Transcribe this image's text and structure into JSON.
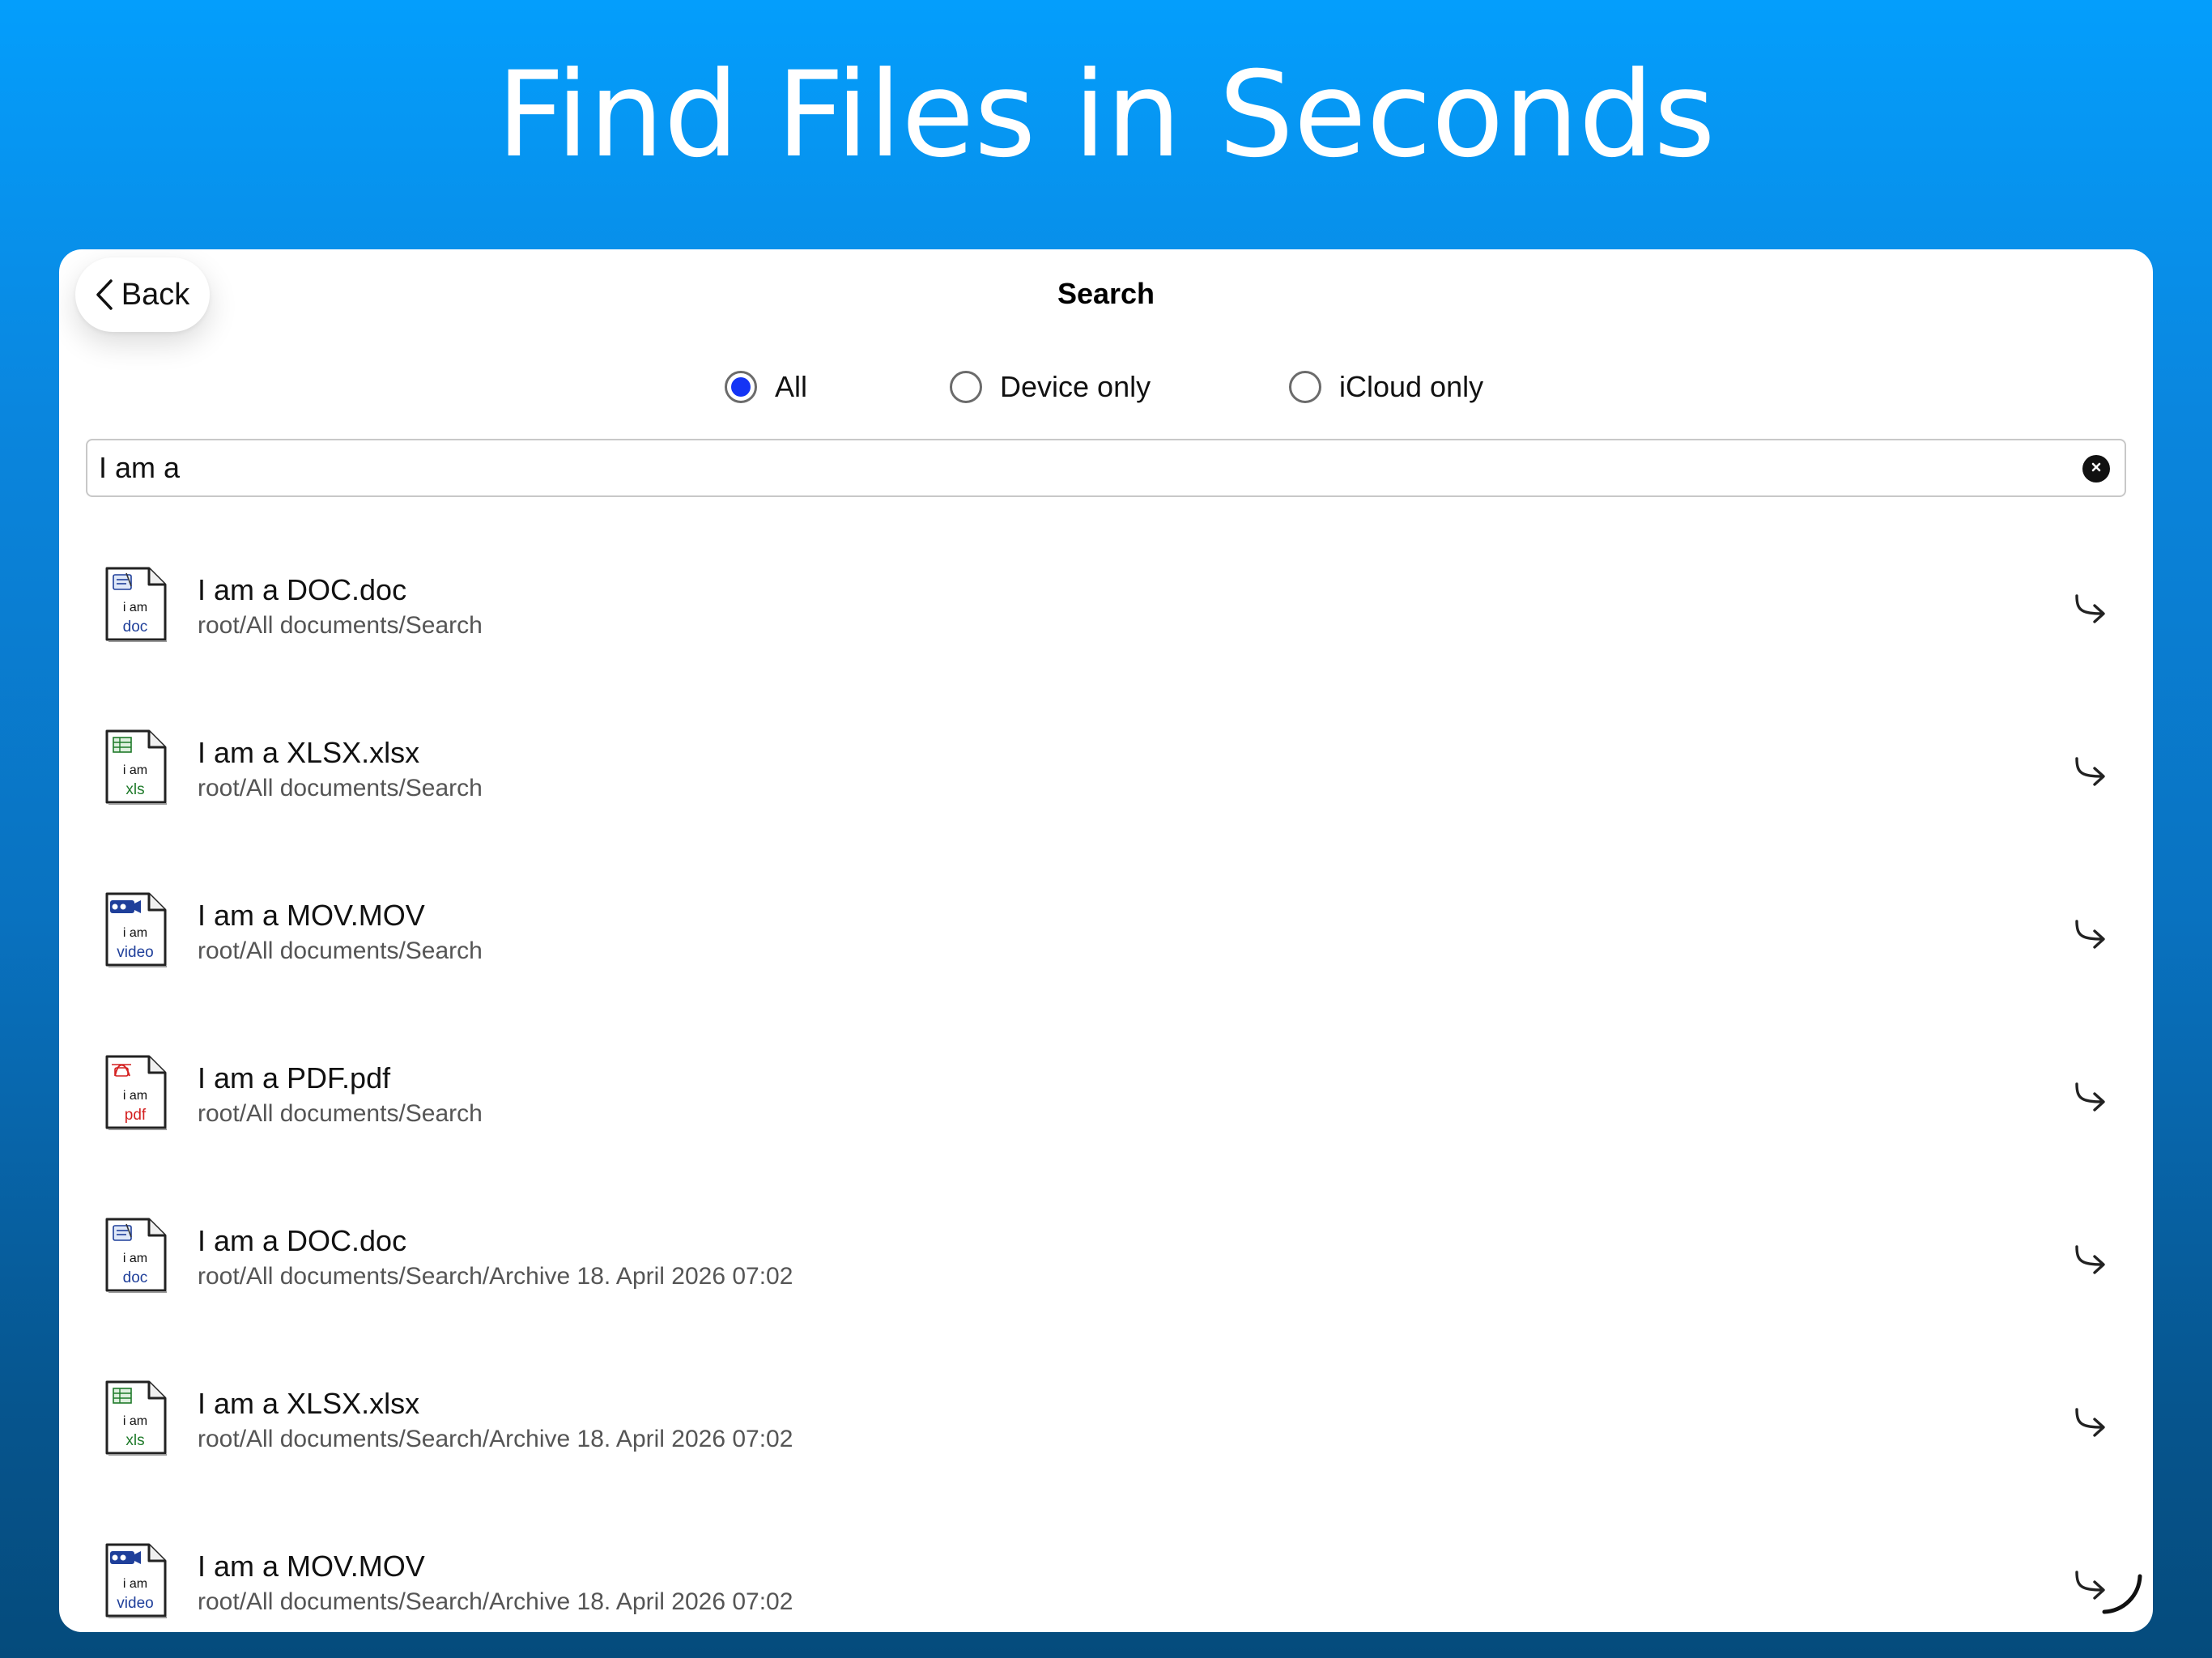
{
  "hero": {
    "title": "Find Files in Seconds"
  },
  "nav": {
    "back_label": "Back",
    "title": "Search"
  },
  "filters": {
    "options": [
      {
        "label": "All",
        "selected": true
      },
      {
        "label": "Device only",
        "selected": false
      },
      {
        "label": "iCloud only",
        "selected": false
      }
    ]
  },
  "search": {
    "value": "I am a"
  },
  "results": [
    {
      "name": "I am a DOC.doc",
      "path": "root/All documents/Search",
      "icon": {
        "line1": "i am",
        "line2": "doc",
        "type": "doc-file-icon",
        "color": "#1f3f9a"
      }
    },
    {
      "name": "I am a XLSX.xlsx",
      "path": "root/All documents/Search",
      "icon": {
        "line1": "i am",
        "line2": "xls",
        "type": "xls-file-icon",
        "color": "#1f7a2a"
      }
    },
    {
      "name": "I am a MOV.MOV",
      "path": "root/All documents/Search",
      "icon": {
        "line1": "i am",
        "line2": "video",
        "type": "video-file-icon",
        "color": "#1f3f9a"
      }
    },
    {
      "name": "I am a PDF.pdf",
      "path": "root/All documents/Search",
      "icon": {
        "line1": "i am",
        "line2": "pdf",
        "type": "pdf-file-icon",
        "color": "#d42020"
      }
    },
    {
      "name": "I am a DOC.doc",
      "path": "root/All documents/Search/Archive 18. April 2026 07:02",
      "icon": {
        "line1": "i am",
        "line2": "doc",
        "type": "doc-file-icon",
        "color": "#1f3f9a"
      }
    },
    {
      "name": "I am a XLSX.xlsx",
      "path": "root/All documents/Search/Archive 18. April 2026 07:02",
      "icon": {
        "line1": "i am",
        "line2": "xls",
        "type": "xls-file-icon",
        "color": "#1f7a2a"
      }
    },
    {
      "name": "I am a MOV.MOV",
      "path": "root/All documents/Search/Archive 18. April 2026 07:02",
      "icon": {
        "line1": "i am",
        "line2": "video",
        "type": "video-file-icon",
        "color": "#1f3f9a"
      }
    }
  ],
  "theme": {
    "accent": "#1434f5",
    "background_top": "#049efc",
    "background_bottom": "#054b7c"
  }
}
